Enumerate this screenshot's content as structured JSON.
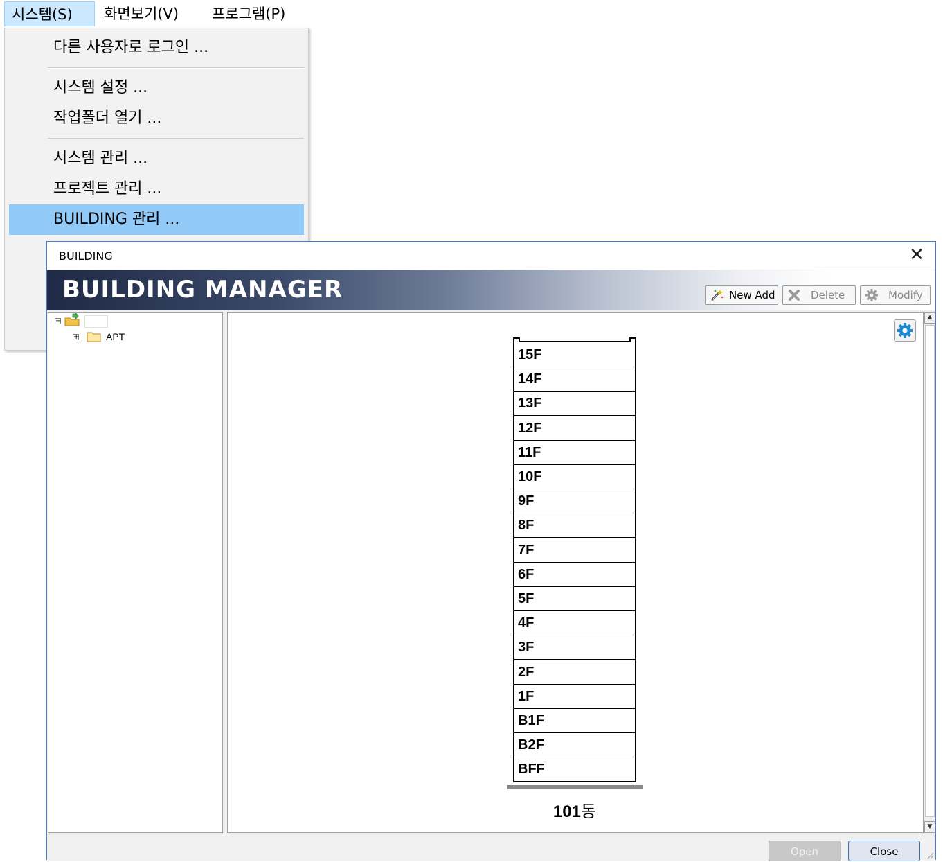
{
  "menubar": {
    "items": [
      {
        "label": "시스템(S)"
      },
      {
        "label": "화면보기(V)"
      },
      {
        "label": "프로그램(P)"
      }
    ]
  },
  "dropdown": {
    "items": [
      {
        "label": "다른 사용자로 로그인 ..."
      },
      {
        "label": "시스템 설정 ..."
      },
      {
        "label": "작업폴더 열기 ..."
      },
      {
        "label": "시스템 관리 ..."
      },
      {
        "label": "프로젝트 관리 ..."
      },
      {
        "label": "BUILDING 관리 ..."
      }
    ]
  },
  "dialog": {
    "title": "BUILDING",
    "close_glyph": "✕",
    "header": "BUILDING MANAGER",
    "toolbar": {
      "new_add": "New Add",
      "delete": "Delete",
      "modify": "Modify"
    },
    "tree": {
      "root_label": "",
      "child_label": "APT"
    },
    "building": {
      "floors": [
        "15F",
        "14F",
        "13F",
        "12F",
        "11F",
        "10F",
        "9F",
        "8F",
        "7F",
        "6F",
        "5F",
        "4F",
        "3F",
        "2F",
        "1F",
        "B1F",
        "B2F",
        "BFF"
      ],
      "name_number": "101",
      "name_suffix": "동"
    },
    "buttons": {
      "open": "Open",
      "close": "Close"
    }
  },
  "colors": {
    "menu_highlight": "#91c9f7",
    "dialog_border": "#3d7fd6",
    "header_dark": "#1e2a46"
  }
}
